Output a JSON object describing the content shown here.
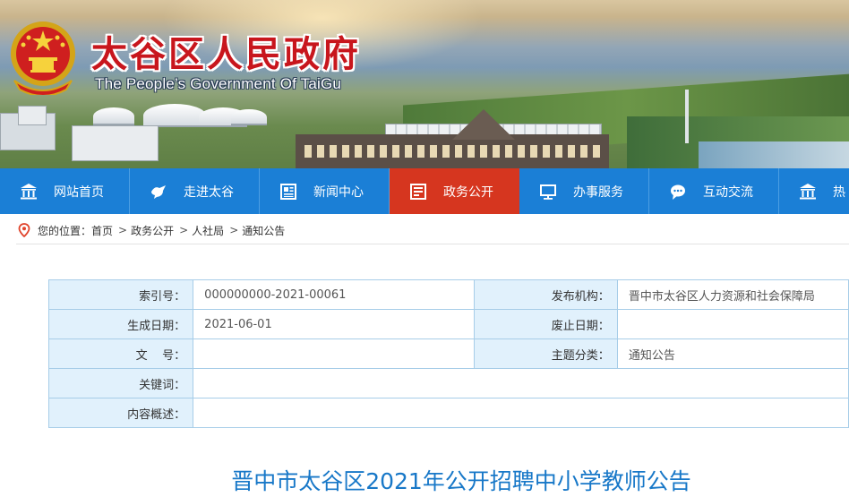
{
  "header": {
    "title": "太谷区人民政府",
    "subtitle": "The People’s Government Of TaiGu",
    "emblem_icon": "national-emblem-icon",
    "title_color": "#c8161d"
  },
  "nav": {
    "bg_color": "#1b7fd6",
    "active_color": "#d6361f",
    "items": [
      {
        "label": "网站首页",
        "icon": "institution-icon"
      },
      {
        "label": "走进太谷",
        "icon": "bird-icon"
      },
      {
        "label": "新闻中心",
        "icon": "newspaper-icon"
      },
      {
        "label": "政务公开",
        "icon": "document-icon",
        "active": true
      },
      {
        "label": "办事服务",
        "icon": "monitor-icon"
      },
      {
        "label": "互动交流",
        "icon": "chat-bubble-icon"
      },
      {
        "label": "热",
        "icon": "institution-icon"
      }
    ]
  },
  "breadcrumb": {
    "icon": "location-pin-icon",
    "prefix": "您的位置：",
    "items": [
      "首页",
      "政务公开",
      "人社局",
      "通知公告"
    ]
  },
  "info": {
    "index_no_label": "索引号：",
    "index_no": "000000000-2021-00061",
    "publisher_label": "发布机构：",
    "publisher": "晋中市太谷区人力资源和社会保障局",
    "created_label": "生成日期：",
    "created": "2021-06-01",
    "abolish_label": "废止日期：",
    "abolish": "",
    "doc_no_label": "文    号：",
    "doc_no": "",
    "topic_label": "主题分类：",
    "topic": "通知公告",
    "keywords_label": "关键词：",
    "keywords": "",
    "summary_label": "内容概述：",
    "summary": ""
  },
  "article": {
    "title": "晋中市太谷区2021年公开招聘中小学教师公告",
    "title_color": "#1878c8"
  }
}
